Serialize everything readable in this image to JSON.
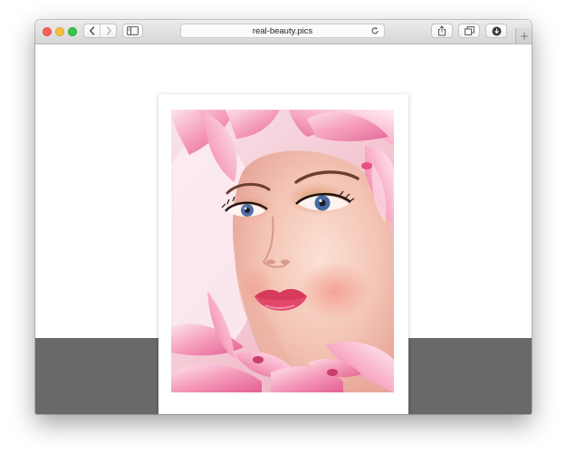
{
  "browser": {
    "url": "real-beauty.pics",
    "buttons": {
      "back": "chevron-left-icon",
      "forward": "chevron-right-icon",
      "sidebar": "sidebar-icon",
      "reload": "reload-icon",
      "share": "share-icon",
      "tabs": "tabs-overview-icon",
      "downloads": "download-icon",
      "new_tab": "plus-icon"
    }
  },
  "page": {
    "photo_subject": "portrait-with-pink-orchids"
  },
  "colors": {
    "close": "#fc605b",
    "minimize": "#fdbc40",
    "maximize": "#34c84a",
    "band": "#696969"
  }
}
